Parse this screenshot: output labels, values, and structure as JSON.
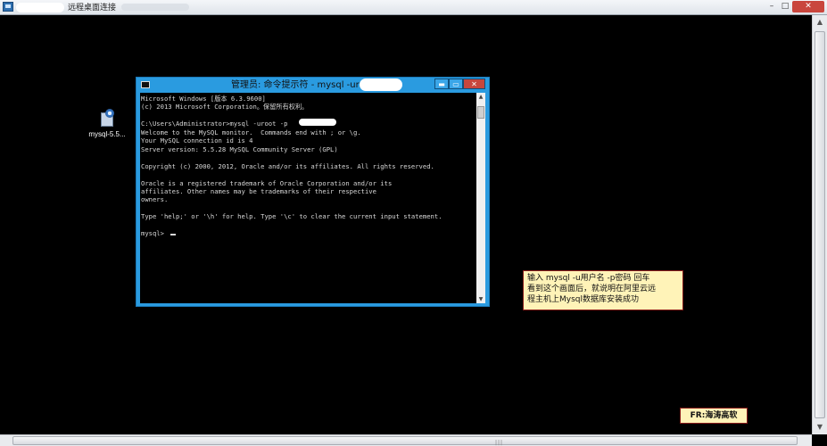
{
  "rdp_window": {
    "title": "远程桌面连接",
    "controls": {
      "minimize": "–",
      "maximize": "□",
      "close": "✕"
    }
  },
  "desktop": {
    "icons": [
      {
        "label": "mysql-5.5...",
        "icon": "installer-icon"
      }
    ]
  },
  "cmd_window": {
    "title": "管理员: 命令提示符 - mysql  -uroot -p",
    "controls": {
      "minimize": "▬",
      "maximize": "▭",
      "close": "✕"
    },
    "console_lines": [
      "Microsoft Windows [版本 6.3.9600]",
      "(c) 2013 Microsoft Corporation。保留所有权利。",
      "",
      "C:\\Users\\Administrator>mysql -uroot -p",
      "Welcome to the MySQL monitor.  Commands end with ; or \\g.",
      "Your MySQL connection id is 4",
      "Server version: 5.5.28 MySQL Community Server (GPL)",
      "",
      "Copyright (c) 2000, 2012, Oracle and/or its affiliates. All rights reserved.",
      "",
      "Oracle is a registered trademark of Oracle Corporation and/or its",
      "affiliates. Other names may be trademarks of their respective",
      "owners.",
      "",
      "Type 'help;' or '\\h' for help. Type '\\c' to clear the current input statement.",
      "",
      "mysql> "
    ]
  },
  "annotation": {
    "lines": [
      "输入 mysql -u用户名 -p密码  回车",
      "看到这个画面后，就说明在阿里云远",
      "程主机上Mysql数据库安装成功"
    ]
  },
  "credit": {
    "text": "FR:海涛高软"
  }
}
